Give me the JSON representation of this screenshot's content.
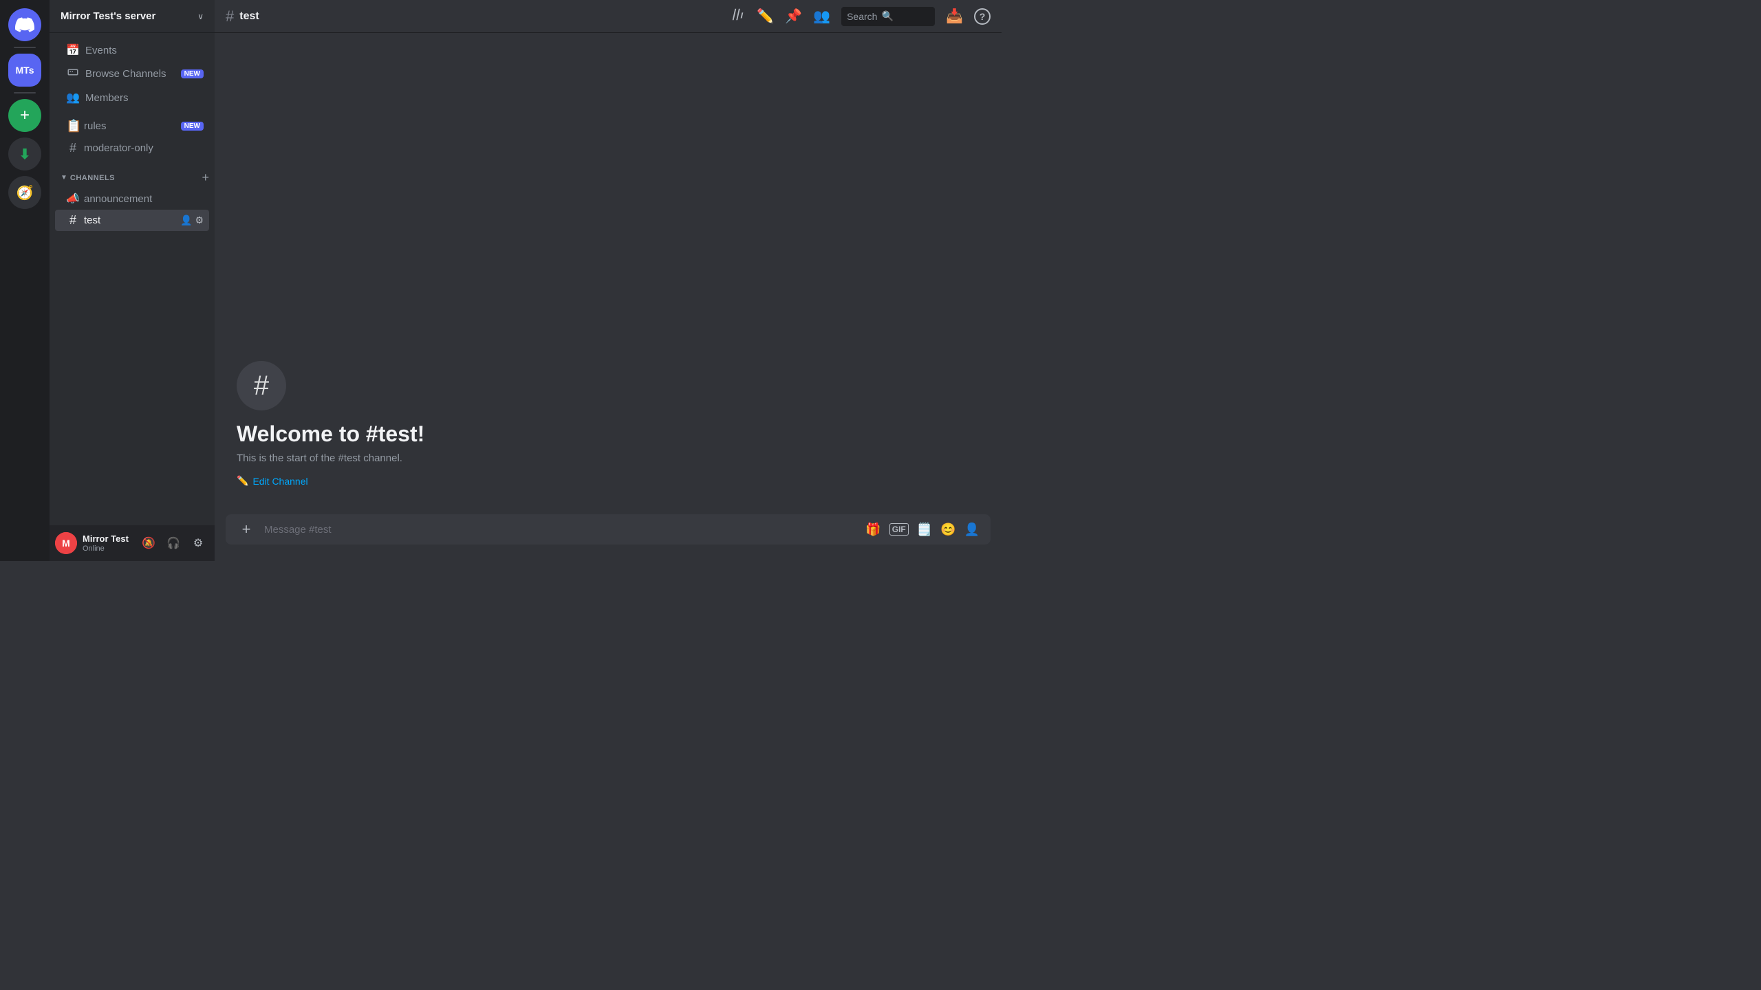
{
  "app": {
    "discord_icon": "🎮"
  },
  "server": {
    "name": "Mirror Test's server",
    "initials": "MTs",
    "chevron": "∨"
  },
  "sidebar": {
    "events_label": "Events",
    "browse_channels_label": "Browse Channels",
    "browse_channels_badge": "NEW",
    "members_label": "Members",
    "rules_label": "rules",
    "rules_badge": "NEW",
    "moderator_label": "moderator-only",
    "channels_category": "CHANNELS",
    "announcement_channel": "announcement",
    "test_channel": "test"
  },
  "user": {
    "name": "Mirror Test",
    "status": "Online",
    "avatar_text": "🔴"
  },
  "topbar": {
    "channel_icon": "#",
    "channel_name": "test",
    "search_placeholder": "Search"
  },
  "welcome": {
    "icon": "#",
    "title": "Welcome to #test!",
    "description": "This is the start of the #test channel.",
    "edit_channel": "Edit Channel"
  },
  "message_input": {
    "placeholder": "Message #test"
  },
  "icons": {
    "pencil": "✏",
    "pin": "📌",
    "members": "👥",
    "inbox": "📥",
    "help": "❓",
    "mute": "🔇",
    "headphones": "🎧",
    "settings": "⚙",
    "gift": "🎁",
    "gif": "GIF",
    "sticker": "🗨",
    "emoji": "😊",
    "members_bar": "👤"
  }
}
